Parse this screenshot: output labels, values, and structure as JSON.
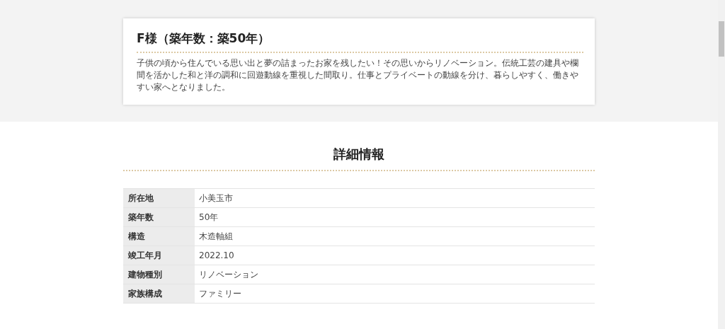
{
  "case": {
    "title": "F様（築年数：築50年）",
    "description": "子供の頃から住んでいる思い出と夢の詰まったお家を残したい！その思いからリノベーション。伝統工芸の建具や欄間を活かした和と洋の調和に回遊動線を重視した間取り。仕事とプライベートの動線を分け、暮らしやすく、働きやすい家へとなりました。"
  },
  "details": {
    "heading": "詳細情報",
    "rows": [
      {
        "label": "所在地",
        "value": "小美玉市"
      },
      {
        "label": "築年数",
        "value": "50年"
      },
      {
        "label": "構造",
        "value": "木造軸組"
      },
      {
        "label": "竣工年月",
        "value": "2022.10"
      },
      {
        "label": "建物種別",
        "value": "リノベーション"
      },
      {
        "label": "家族構成",
        "value": "ファミリー"
      }
    ]
  }
}
